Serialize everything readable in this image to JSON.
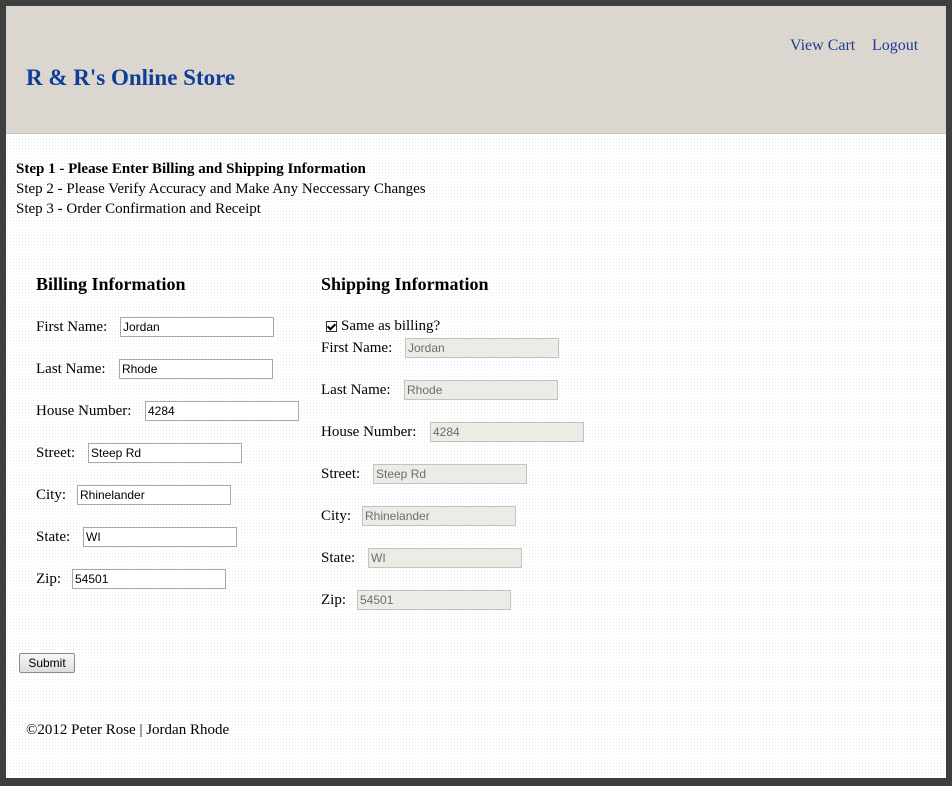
{
  "header": {
    "site_title": "R & R's Online Store",
    "nav": {
      "view_cart": "View Cart",
      "logout": "Logout"
    }
  },
  "steps": [
    "Step 1 - Please Enter Billing and Shipping Information",
    "Step 2 - Please Verify Accuracy and Make Any Neccessary Changes",
    "Step 3 - Order Confirmation and Receipt"
  ],
  "billing": {
    "heading": "Billing Information",
    "first_name": {
      "label": "First Name:",
      "value": "Jordan"
    },
    "last_name": {
      "label": "Last Name:",
      "value": "Rhode"
    },
    "house_number": {
      "label": "House Number:",
      "value": "4284"
    },
    "street": {
      "label": "Street:",
      "value": "Steep Rd"
    },
    "city": {
      "label": "City:",
      "value": "Rhinelander"
    },
    "state": {
      "label": "State:",
      "value": "WI"
    },
    "zip": {
      "label": "Zip:",
      "value": "54501"
    }
  },
  "shipping": {
    "heading": "Shipping Information",
    "same_as_billing": {
      "label": "Same as billing?",
      "checked": true
    },
    "first_name": {
      "label": "First Name:",
      "value": "Jordan"
    },
    "last_name": {
      "label": "Last Name:",
      "value": "Rhode"
    },
    "house_number": {
      "label": "House Number:",
      "value": "4284"
    },
    "street": {
      "label": "Street:",
      "value": "Steep Rd"
    },
    "city": {
      "label": "City:",
      "value": "Rhinelander"
    },
    "state": {
      "label": "State:",
      "value": "WI"
    },
    "zip": {
      "label": "Zip:",
      "value": "54501"
    }
  },
  "form": {
    "submit_label": "Submit"
  },
  "footer": {
    "text": "©2012 Peter Rose | Jordan Rhode"
  },
  "colors": {
    "title": "#0f3d9a",
    "link": "#1f3c8f",
    "header_bg": "#dcd8d1",
    "frame_border": "#3f3f3f"
  }
}
